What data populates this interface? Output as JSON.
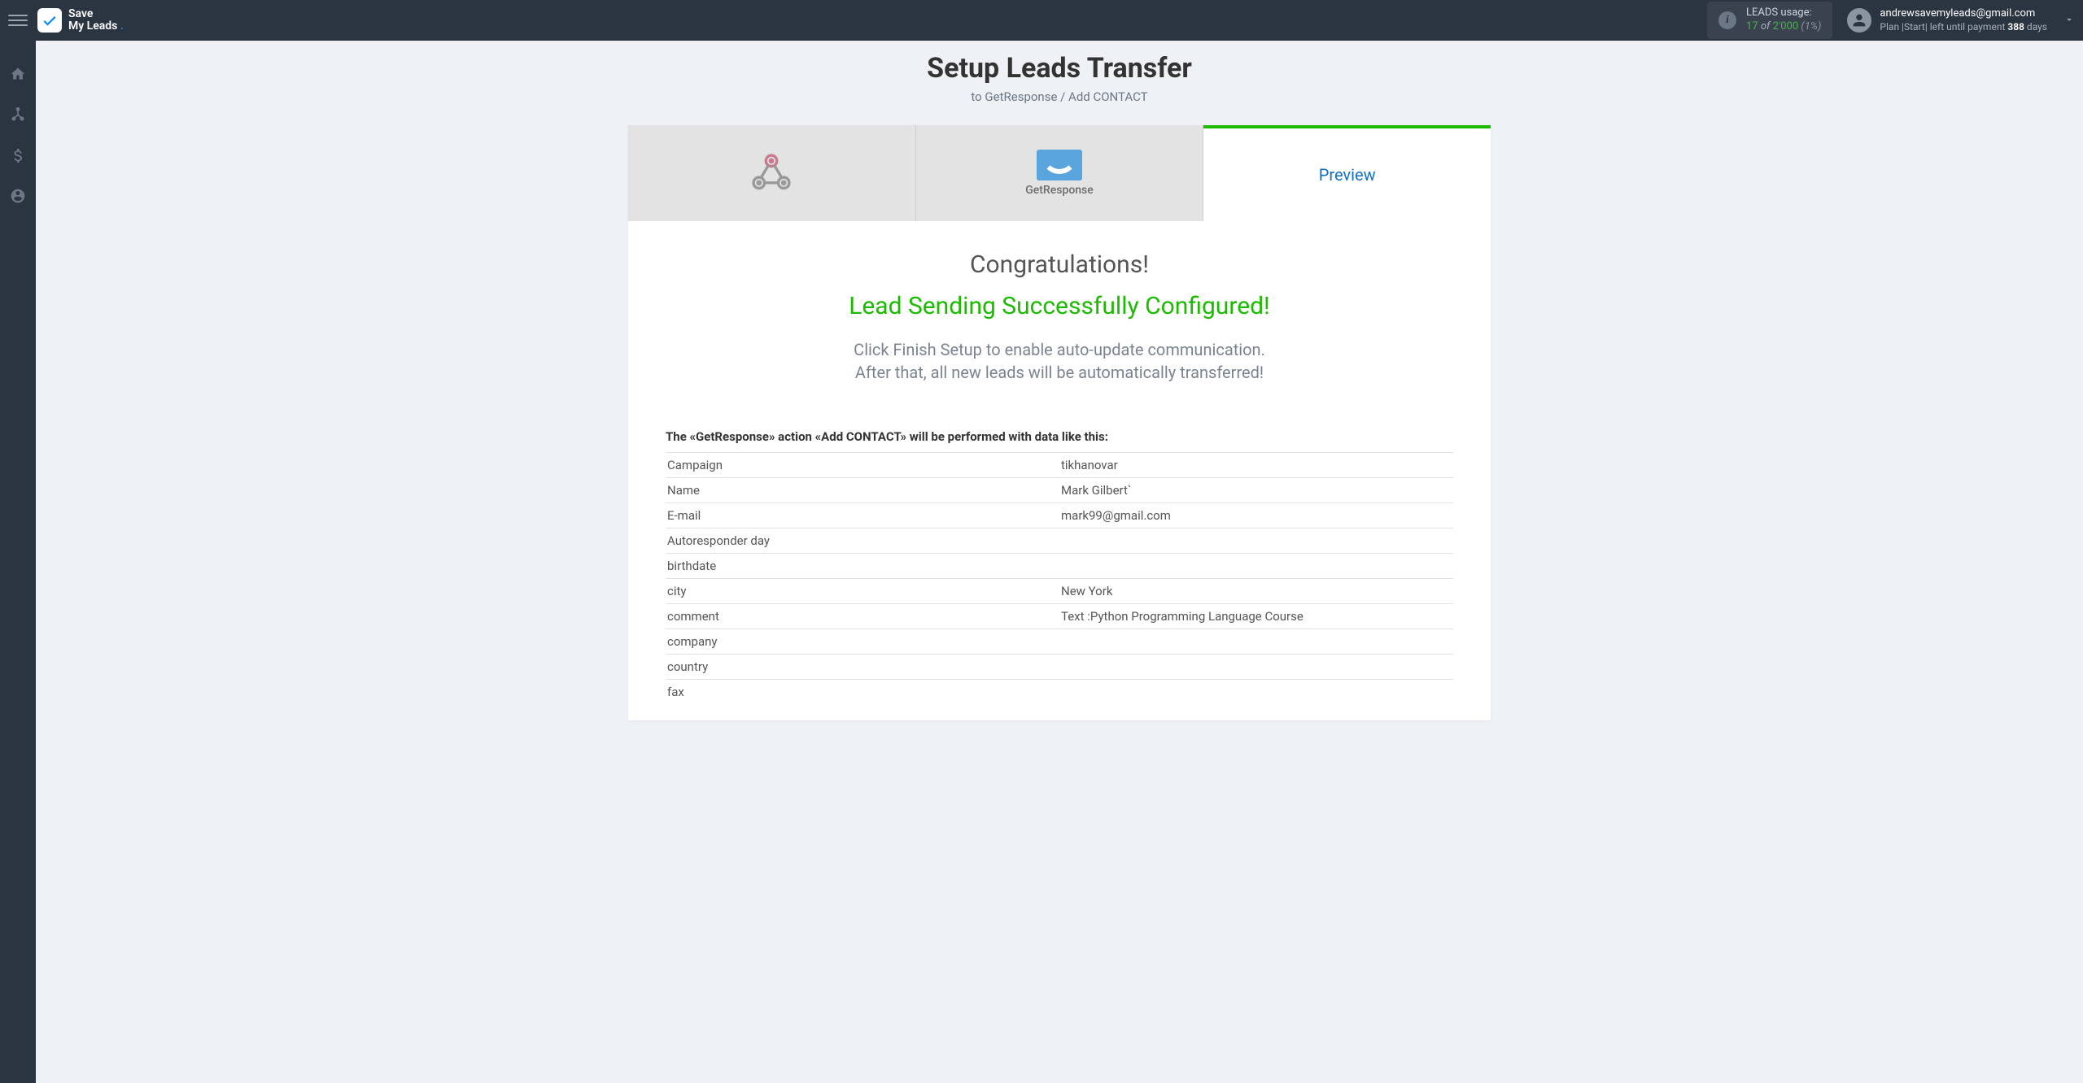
{
  "brand": {
    "line1": "Save",
    "line2": "My Leads"
  },
  "usage": {
    "label": "LEADS usage:",
    "used": "17",
    "of": "of",
    "total": "2'000",
    "pct": "(1%)"
  },
  "account": {
    "email": "andrewsavemyleads@gmail.com",
    "plan_prefix": "Plan |Start| left until payment",
    "days": "388",
    "days_suffix": "days"
  },
  "page": {
    "title": "Setup Leads Transfer",
    "subtitle": "to GetResponse / Add CONTACT"
  },
  "tabs": {
    "getresponse_label": "GetResponse",
    "preview_label": "Preview"
  },
  "messages": {
    "congrats": "Congratulations!",
    "success": "Lead Sending Successfully Configured!",
    "hint1": "Click Finish Setup to enable auto-update communication.",
    "hint2": "After that, all new leads will be automatically transferred!"
  },
  "action_title": "The «GetResponse» action «Add CONTACT» will be performed with data like this:",
  "rows": [
    {
      "key": "Campaign",
      "val": "tikhanovar"
    },
    {
      "key": "Name",
      "val": "Mark Gilbert`"
    },
    {
      "key": "E-mail",
      "val": "mark99@gmail.com"
    },
    {
      "key": "Autoresponder day",
      "val": ""
    },
    {
      "key": "birthdate",
      "val": ""
    },
    {
      "key": "city",
      "val": "New York"
    },
    {
      "key": "comment",
      "val": "Text :Python Programming Language Course"
    },
    {
      "key": "company",
      "val": ""
    },
    {
      "key": "country",
      "val": ""
    },
    {
      "key": "fax",
      "val": ""
    }
  ]
}
